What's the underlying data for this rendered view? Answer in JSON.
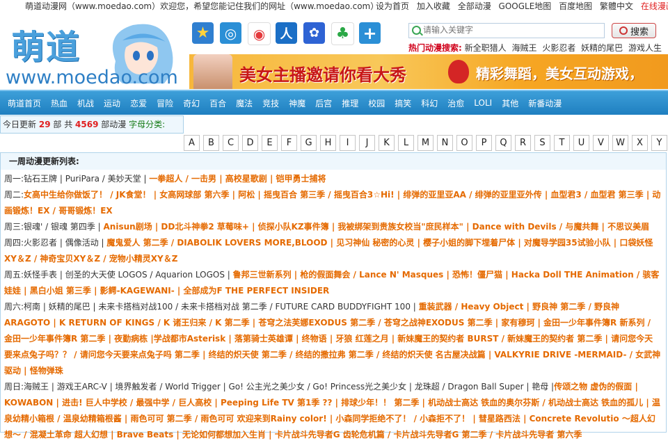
{
  "topbar": {
    "welcome": "萌道动漫网（www.moedao.com）欢迎您，希望您能记住我们的网址（www.moedao.com）",
    "links": [
      "设为首页",
      "加入收藏",
      "全部动漫",
      "GOOGLE地图",
      "百度地图",
      "繁體中文"
    ],
    "online_manga": "在线漫画"
  },
  "logo": {
    "cn": "萌道",
    "en": "www.moedao.com"
  },
  "icons": [
    {
      "name": "star-icon",
      "glyph": "★",
      "color": "#2f7fd0"
    },
    {
      "name": "qzone-icon",
      "glyph": "◎",
      "color": "#2b8fd6"
    },
    {
      "name": "weibo-icon",
      "glyph": "◉",
      "color": "#e4393c"
    },
    {
      "name": "renren-icon",
      "glyph": "人",
      "color": "#1b6fc6"
    },
    {
      "name": "baidu-paw-icon",
      "glyph": "✿",
      "color": "#2e63d4"
    },
    {
      "name": "clover-icon",
      "glyph": "♣",
      "color": "#2aa846"
    },
    {
      "name": "plus-icon",
      "glyph": "+",
      "color": "#2b8fd6"
    }
  ],
  "search": {
    "placeholder": "请输入关键字",
    "button": "搜索"
  },
  "hot": {
    "label": "热门动漫搜索:",
    "items": [
      "新全职猎人",
      "海贼王",
      "火影忍者",
      "妖精的尾巴",
      "游戏人生"
    ]
  },
  "banner": {
    "text1": "美女主播邀请你看大秀",
    "text2": "精彩舞蹈，美女互动游戏，"
  },
  "nav": [
    "萌道首页",
    "热血",
    "机战",
    "运动",
    "恋爱",
    "冒险",
    "奇幻",
    "百合",
    "魔法",
    "竞技",
    "神魔",
    "后宫",
    "推理",
    "校园",
    "搞笑",
    "科幻",
    "治愈",
    "LOLI",
    "其他",
    "新番动漫"
  ],
  "today": {
    "prefix": "今日更新",
    "count": "29",
    "mid": "部 共",
    "total": "4569",
    "suffix": "部动漫",
    "letters_label": "字母分类:"
  },
  "letters": [
    "A",
    "B",
    "C",
    "D",
    "E",
    "F",
    "G",
    "H",
    "I",
    "J",
    "K",
    "L",
    "M",
    "N",
    "O",
    "P",
    "Q",
    "R",
    "S",
    "T",
    "U",
    "V",
    "W",
    "X",
    "Y",
    "Z"
  ],
  "week": {
    "title": "一周动漫更新列表:",
    "days": [
      {
        "label": "周一:",
        "normal": "钻石王牌 | PuriPara / 美妙天堂 | ",
        "orange": "一拳超人 / 一击男 | 高校星歌剧 | 铠甲勇士捕将"
      },
      {
        "label": "周二:",
        "normal": "",
        "orange": "女高中生给你做饭了！ / JK食堂！ | 女高网球部 第六季 | 阿松 | 摇曳百合 第三季 / 摇曳百合3☆Hi! | 绯弹的亚里亚AA / 绯弹的亚里亚外传 | 血型君3 / 血型君 第三季 | 动画锻炼！EX / 哥哥锻炼！EX"
      },
      {
        "label": "周三:",
        "normal": "银魂' / 银魂 第四季 | ",
        "orange": "Anisun剧场 | DD北斗神拳2 草莓味+ | 侦探小队KZ事件簿 | 我被绑架到贵族女校当\"庶民样本\" | Dance with Devils / 与魔共舞 | 不思议美眉"
      },
      {
        "label": "周四:",
        "normal": "火影忍者 | 偶像活动 | ",
        "orange": "魔鬼爱人 第二季 / DIABOLIK LOVERS MORE,BLOOD | 见习神仙 秘密的心灵 | 樱子小姐的脚下埋着尸体 | 对魔导学园35试验小队 | 口袋妖怪XY＆Z / 神奇宝贝XY＆Z / 宠物小精灵XY＆Z"
      },
      {
        "label": "周五:",
        "normal": "妖怪手表 | 创圣的大天使 LOGOS / Aquarion LOGOS | ",
        "orange": "鲁邦三世新系列 | 枪的假面舞会 / Lance N' Masques | 恐怖！僵尸猫 | Hacka Doll THE Animation / 骇客娃娃 | 黑白小姐 第三季 | 影鳄-KAGEWANI- | 全部成为F THE PERFECT INSIDER"
      },
      {
        "label": "周六:",
        "normal": "柯南 | 妖精的尾巴 | 未来卡搭档对战100 / 未来卡搭档对战 第二季 / FUTURE CARD BUDDYFIGHT 100 | ",
        "orange": "重装武器 / Heavy Object | 野良神 第二季 / 野良神 ARAGOTO | K RETURN OF KINGS / K 诸王归来 / K 第二季 | 苍穹之法芙娜EXODUS 第二季 / 苍穹之战神EXODUS 第二季 | 家有穆珂 | 金田一少年事件簿R 新系列 / 金田一少年事件簿R 第二季 | 夜勤病栋 |学战都市Asterisk | 落第骑士英雄谭 | 终物语 | 牙狼 红莲之月 | 新妹魔王的契约者 BURST / 新妹魔王的契约者 第二季 | 请问您今天要来点兔子吗？？ / 请问您今天要来点兔子吗 第二季 | 终结的炽天使 第二季 / 终结的撒拉弗 第二季 / 终结的炽天使 名古屋决战篇 | VALKYRIE DRIVE -MERMAID- / 女武神驱动 | 怪物弹珠"
      },
      {
        "label": "周日:",
        "normal": "海贼王 | 游戏王ARC-V | 境界触发者 / World Trigger | Go! 公主光之美少女 / Go! Princess光之美少女 | 龙珠超 / Dragon Ball Super | 艳母 |",
        "orange": "传颂之物 虚伪的假面 | KOWABON | 进击! 巨人中学校 / 最强中学 / 巨人高校 | Peeping Life TV 第1季 ?? | 排球少年！！ 第二季 | 机动战士高达 铁血的奥尔芬斯 / 机动战士高达 铁血的孤儿 | 温泉幼精小箱根 / 温泉幼精箱根酱 | 雨色可可 第二季 / 雨色可可 欢迎来到Rainy color! | 小森同学拒绝不了！ / 小森拒不了！ | 彗星路西法 | Concrete Revolutio ～超人幻想～ / 混凝土革命 超人幻想 | Brave Beats | 无论如何都想加入生肖 | 卡片战斗先导者G 齿轮危机篇 / 卡片战斗先导者G 第二季 / 卡片战斗先导者 第六季"
      }
    ]
  }
}
